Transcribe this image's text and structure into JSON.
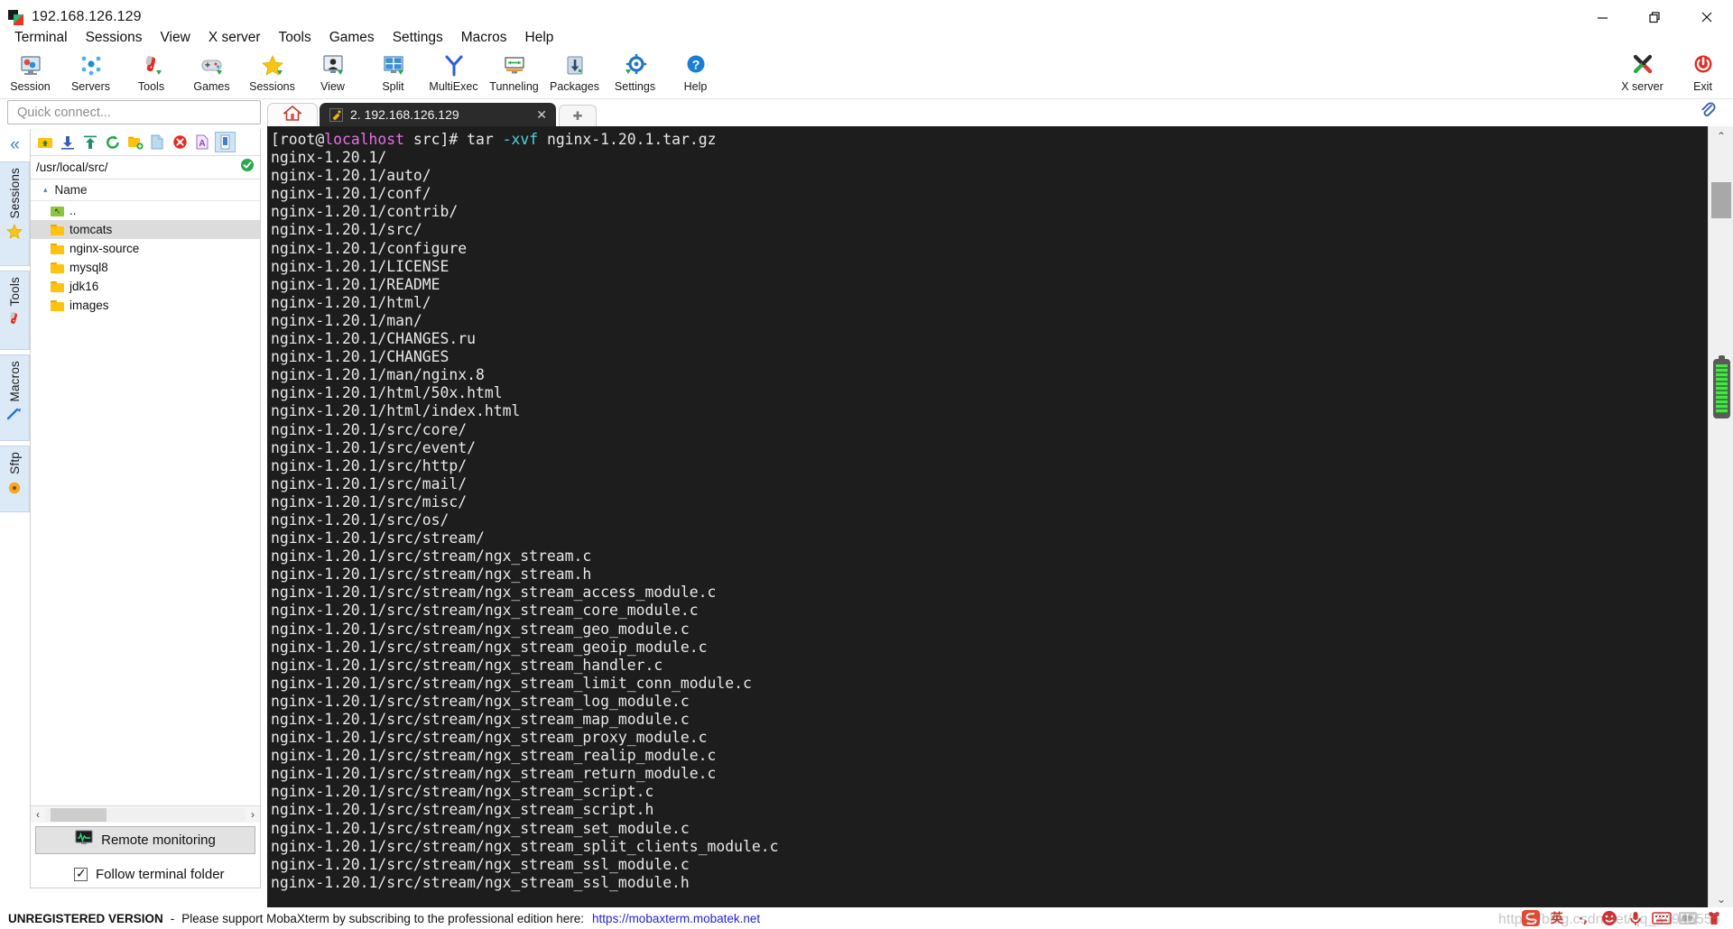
{
  "window": {
    "title": "192.168.126.129",
    "minimize_label": "—",
    "maximize_label": "❐",
    "close_label": "✕"
  },
  "menubar": {
    "items": [
      {
        "label": "Terminal"
      },
      {
        "label": "Sessions"
      },
      {
        "label": "View"
      },
      {
        "label": "X server"
      },
      {
        "label": "Tools"
      },
      {
        "label": "Games"
      },
      {
        "label": "Settings"
      },
      {
        "label": "Macros"
      },
      {
        "label": "Help"
      }
    ]
  },
  "toolbar": {
    "items": [
      {
        "label": "Session",
        "icon": "session-icon"
      },
      {
        "label": "Servers",
        "icon": "servers-icon"
      },
      {
        "label": "Tools",
        "icon": "tools-icon"
      },
      {
        "label": "Games",
        "icon": "games-icon"
      },
      {
        "label": "Sessions",
        "icon": "star-icon"
      },
      {
        "label": "View",
        "icon": "view-icon"
      },
      {
        "label": "Split",
        "icon": "split-icon"
      },
      {
        "label": "MultiExec",
        "icon": "multiexec-icon"
      },
      {
        "label": "Tunneling",
        "icon": "tunneling-icon"
      },
      {
        "label": "Packages",
        "icon": "packages-icon"
      },
      {
        "label": "Settings",
        "icon": "gear-icon"
      },
      {
        "label": "Help",
        "icon": "help-icon"
      }
    ],
    "right_items": [
      {
        "label": "X server",
        "icon": "xserver-icon"
      },
      {
        "label": "Exit",
        "icon": "power-icon"
      }
    ]
  },
  "quick_connect": {
    "placeholder": "Quick connect..."
  },
  "side_ribbon": {
    "collapse_label": "«",
    "tabs": [
      {
        "label": "Sessions",
        "icon": "star-icon"
      },
      {
        "label": "Tools",
        "icon": "swissknife-icon"
      },
      {
        "label": "Macros",
        "icon": "macro-icon"
      },
      {
        "label": "Sftp",
        "icon": "sftp-icon"
      }
    ]
  },
  "sftp": {
    "toolbar_buttons": [
      {
        "name": "go-up-icon"
      },
      {
        "name": "download-icon"
      },
      {
        "name": "upload-icon"
      },
      {
        "name": "refresh-icon"
      },
      {
        "name": "new-folder-icon"
      },
      {
        "name": "new-file-icon"
      },
      {
        "name": "delete-icon"
      },
      {
        "name": "rename-icon"
      },
      {
        "name": "file-preview-icon"
      }
    ],
    "path": "/usr/local/src/",
    "path_ok_icon": "check-circle-icon",
    "column_header": "Name",
    "sort_arrow": "▴",
    "rows": [
      {
        "name": "..",
        "type": "parent",
        "selected": false
      },
      {
        "name": "tomcats",
        "type": "folder",
        "selected": true
      },
      {
        "name": "nginx-source",
        "type": "folder",
        "selected": false
      },
      {
        "name": "mysql8",
        "type": "folder",
        "selected": false
      },
      {
        "name": "jdk16",
        "type": "folder",
        "selected": false
      },
      {
        "name": "images",
        "type": "folder",
        "selected": false
      }
    ],
    "hscroll_left": "‹",
    "hscroll_right": "›",
    "remote_monitoring_label": "Remote monitoring",
    "follow_terminal_folder_label": "Follow terminal folder",
    "follow_terminal_folder_checked": true
  },
  "tabs": {
    "home_icon": "home-icon",
    "terminal_tab": {
      "icon": "ssh-key-icon",
      "label": "2. 192.168.126.129",
      "close": "✕"
    },
    "new_tab": "✚",
    "clip_icon": "paperclip-icon"
  },
  "terminal": {
    "prompt": {
      "pre": "[root@",
      "host": "localhost",
      "post": " src]# tar ",
      "flag": "-xvf",
      "tail": " nginx-1.20.1.tar.gz"
    },
    "lines": [
      "nginx-1.20.1/",
      "nginx-1.20.1/auto/",
      "nginx-1.20.1/conf/",
      "nginx-1.20.1/contrib/",
      "nginx-1.20.1/src/",
      "nginx-1.20.1/configure",
      "nginx-1.20.1/LICENSE",
      "nginx-1.20.1/README",
      "nginx-1.20.1/html/",
      "nginx-1.20.1/man/",
      "nginx-1.20.1/CHANGES.ru",
      "nginx-1.20.1/CHANGES",
      "nginx-1.20.1/man/nginx.8",
      "nginx-1.20.1/html/50x.html",
      "nginx-1.20.1/html/index.html",
      "nginx-1.20.1/src/core/",
      "nginx-1.20.1/src/event/",
      "nginx-1.20.1/src/http/",
      "nginx-1.20.1/src/mail/",
      "nginx-1.20.1/src/misc/",
      "nginx-1.20.1/src/os/",
      "nginx-1.20.1/src/stream/",
      "nginx-1.20.1/src/stream/ngx_stream.c",
      "nginx-1.20.1/src/stream/ngx_stream.h",
      "nginx-1.20.1/src/stream/ngx_stream_access_module.c",
      "nginx-1.20.1/src/stream/ngx_stream_core_module.c",
      "nginx-1.20.1/src/stream/ngx_stream_geo_module.c",
      "nginx-1.20.1/src/stream/ngx_stream_geoip_module.c",
      "nginx-1.20.1/src/stream/ngx_stream_handler.c",
      "nginx-1.20.1/src/stream/ngx_stream_limit_conn_module.c",
      "nginx-1.20.1/src/stream/ngx_stream_log_module.c",
      "nginx-1.20.1/src/stream/ngx_stream_map_module.c",
      "nginx-1.20.1/src/stream/ngx_stream_proxy_module.c",
      "nginx-1.20.1/src/stream/ngx_stream_realip_module.c",
      "nginx-1.20.1/src/stream/ngx_stream_return_module.c",
      "nginx-1.20.1/src/stream/ngx_stream_script.c",
      "nginx-1.20.1/src/stream/ngx_stream_script.h",
      "nginx-1.20.1/src/stream/ngx_stream_set_module.c",
      "nginx-1.20.1/src/stream/ngx_stream_split_clients_module.c",
      "nginx-1.20.1/src/stream/ngx_stream_ssl_module.c",
      "nginx-1.20.1/src/stream/ngx_stream_ssl_module.h"
    ],
    "colors": {
      "background": "#1d1d1d",
      "foreground": "#e8e8e8",
      "host": "#e86fe8",
      "flag": "#4fd2de"
    }
  },
  "scrollbar": {
    "up_arrow": "⌃",
    "down_arrow": "⌄"
  },
  "statusbar": {
    "unregistered": "UNREGISTERED VERSION",
    "dash": "-",
    "message": "Please support MobaXterm by subscribing to the professional edition here:",
    "link": "https://mobaxterm.mobatek.net",
    "tray_icons": [
      "sogou-icon",
      "ime-lang-icon",
      "ime-punct-icon",
      "ime-emoji-icon",
      "ime-voice-icon",
      "ime-keyboard-icon",
      "ime-image-icon",
      "ime-skin-icon"
    ]
  },
  "watermark": {
    "text": "https://blog.csdn.net/qq_34945555"
  }
}
